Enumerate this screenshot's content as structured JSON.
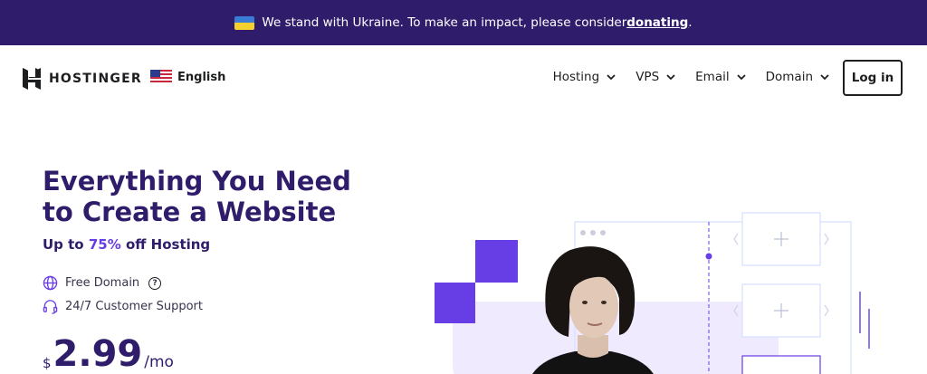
{
  "banner": {
    "text": "We stand with Ukraine. To make an impact, please consider ",
    "link": "donating",
    "suffix": "."
  },
  "nav": {
    "brand": "HOSTINGER",
    "language": "English",
    "menu": [
      {
        "label": "Hosting"
      },
      {
        "label": "VPS"
      },
      {
        "label": "Email"
      },
      {
        "label": "Domain"
      }
    ],
    "login": "Log in"
  },
  "hero": {
    "title": "Everything You Need to Create a Website",
    "discount_prefix": "Up to ",
    "discount_value": "75%",
    "discount_suffix": " off Hosting",
    "features": [
      "Free Domain",
      "24/7 Customer Support"
    ],
    "price": {
      "currency": "$",
      "amount": "2.99",
      "period": "/mo"
    }
  },
  "colors": {
    "banner_bg": "#2f1c6a",
    "primary": "#673de6",
    "heading": "#2f1c6a"
  },
  "icons": [
    "ukraine-flag-icon",
    "hostinger-logo-icon",
    "us-flag-icon",
    "chevron-down-icon",
    "globe-icon",
    "help-icon",
    "headset-icon"
  ]
}
